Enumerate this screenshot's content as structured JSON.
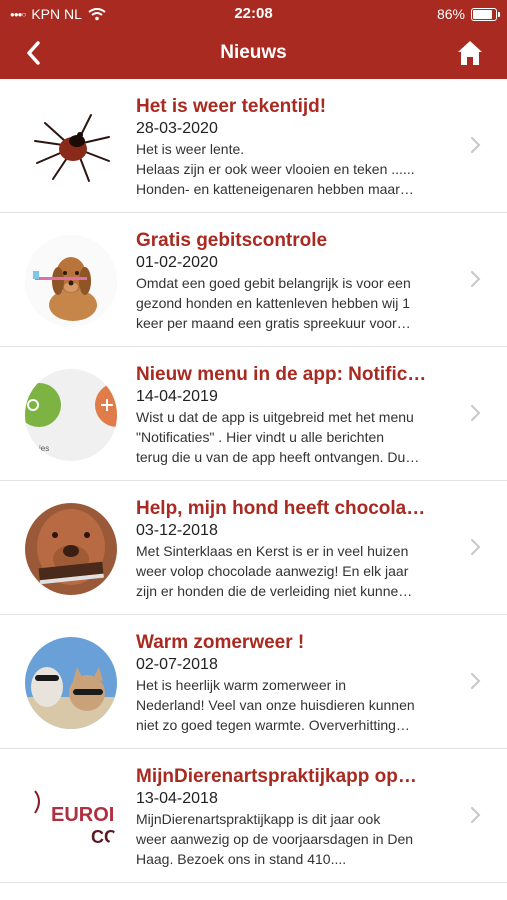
{
  "status": {
    "carrier": "KPN NL",
    "time": "22:08",
    "battery": "86%"
  },
  "nav": {
    "title": "Nieuws"
  },
  "items": [
    {
      "title": "Het is weer tekentijd!",
      "date": "28-03-2020",
      "lines": [
        "Het is weer lente.",
        "Helaas zijn er ook weer vlooien en teken ......",
        "Honden- en katteneigenaren hebben maar…"
      ]
    },
    {
      "title": "Gratis gebitscontrole",
      "date": "01-02-2020",
      "lines": [
        "Omdat een goed gebit belangrijk is voor een",
        "gezond honden en kattenleven hebben wij 1",
        "keer per maand een gratis spreekuur voor…"
      ]
    },
    {
      "title": "Nieuw menu in de app: Notific…",
      "date": "14-04-2019",
      "lines": [
        "Wist u dat de app is uitgebreid met het menu",
        "\"Notificaties\" . Hier vindt u alle berichten",
        "terug die u van de app heeft ontvangen. Du…"
      ]
    },
    {
      "title": "Help, mijn hond heeft chocola…",
      "date": "03-12-2018",
      "lines": [
        "Met Sinterklaas en Kerst is er in veel huizen",
        "weer volop chocolade aanwezig! En elk jaar",
        "zijn er honden die de verleiding niet kunne…"
      ]
    },
    {
      "title": "Warm zomerweer !",
      "date": "02-07-2018",
      "lines": [
        "Het is heerlijk warm zomerweer in",
        "Nederland! Veel van onze huisdieren kunnen",
        "niet zo goed tegen warmte. Oververhitting…"
      ]
    },
    {
      "title": "MijnDierenartspraktijkapp op…",
      "date": "13-04-2018",
      "lines": [
        "MijnDierenartspraktijkapp is dit jaar ook",
        "weer aanwezig op de voorjaarsdagen in Den",
        "Haag. Bezoek ons in stand 410...."
      ]
    }
  ],
  "thumb_text": {
    "menu_label": "ies",
    "logo_top": "EUROI",
    "logo_bottom": "CC"
  },
  "colors": {
    "brand": "#a82a20",
    "chevron": "#c7c7cc"
  }
}
